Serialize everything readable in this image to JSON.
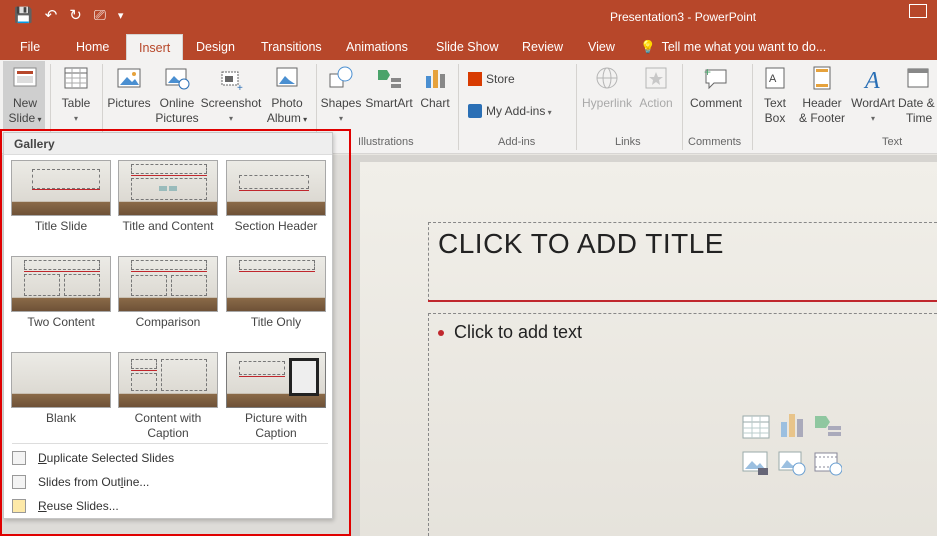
{
  "window": {
    "title": "Presentation3  -  PowerPoint"
  },
  "qat": {
    "save": "💾",
    "undo": "↶",
    "redo": "↻",
    "present": "⎚",
    "more": "▾"
  },
  "tabs": [
    {
      "label": "File"
    },
    {
      "label": "Home"
    },
    {
      "label": "Insert"
    },
    {
      "label": "Design"
    },
    {
      "label": "Transitions"
    },
    {
      "label": "Animations"
    },
    {
      "label": "Slide Show"
    },
    {
      "label": "Review"
    },
    {
      "label": "View"
    }
  ],
  "tell_me": "Tell me what you want to do...",
  "ribbon": {
    "new_slide": {
      "line1": "New",
      "line2": "Slide"
    },
    "table": "Table",
    "pictures": "Pictures",
    "online_pictures": {
      "line1": "Online",
      "line2": "Pictures"
    },
    "screenshot": "Screenshot",
    "photo_album": {
      "line1": "Photo",
      "line2": "Album"
    },
    "shapes": "Shapes",
    "smartart": "SmartArt",
    "chart": "Chart",
    "illustrations_label": "Illustrations",
    "store": "Store",
    "my_addins": "My Add-ins",
    "addins_label": "Add-ins",
    "hyperlink": "Hyperlink",
    "action": "Action",
    "links_label": "Links",
    "comment": "Comment",
    "comments_label": "Comments",
    "text_box": {
      "line1": "Text",
      "line2": "Box"
    },
    "header_footer": {
      "line1": "Header",
      "line2": "& Footer"
    },
    "wordart": "WordArt",
    "date_time": {
      "line1": "Date &",
      "line2": "Time"
    },
    "text_label": "Text"
  },
  "gallery": {
    "header": "Gallery",
    "layouts": [
      {
        "label": "Title Slide"
      },
      {
        "label": "Title and Content"
      },
      {
        "label": "Section Header"
      },
      {
        "label": "Two Content"
      },
      {
        "label": "Comparison"
      },
      {
        "label": "Title Only"
      },
      {
        "label": "Blank"
      },
      {
        "label_1": "Content with",
        "label_2": "Caption"
      },
      {
        "label_1": "Picture with",
        "label_2": "Caption"
      }
    ],
    "menu": {
      "duplicate": {
        "pre": "",
        "u": "D",
        "post": "uplicate Selected Slides"
      },
      "outline": {
        "pre": "Slides from Out",
        "u": "l",
        "post": "ine..."
      },
      "reuse": {
        "pre": "",
        "u": "R",
        "post": "euse Slides..."
      }
    }
  },
  "slide": {
    "title_placeholder": "CLICK TO ADD TITLE",
    "body_placeholder": "Click to add text"
  },
  "colors": {
    "accent": "#b7472a",
    "highlight": "#e00000",
    "slide_red": "#c0272d"
  }
}
